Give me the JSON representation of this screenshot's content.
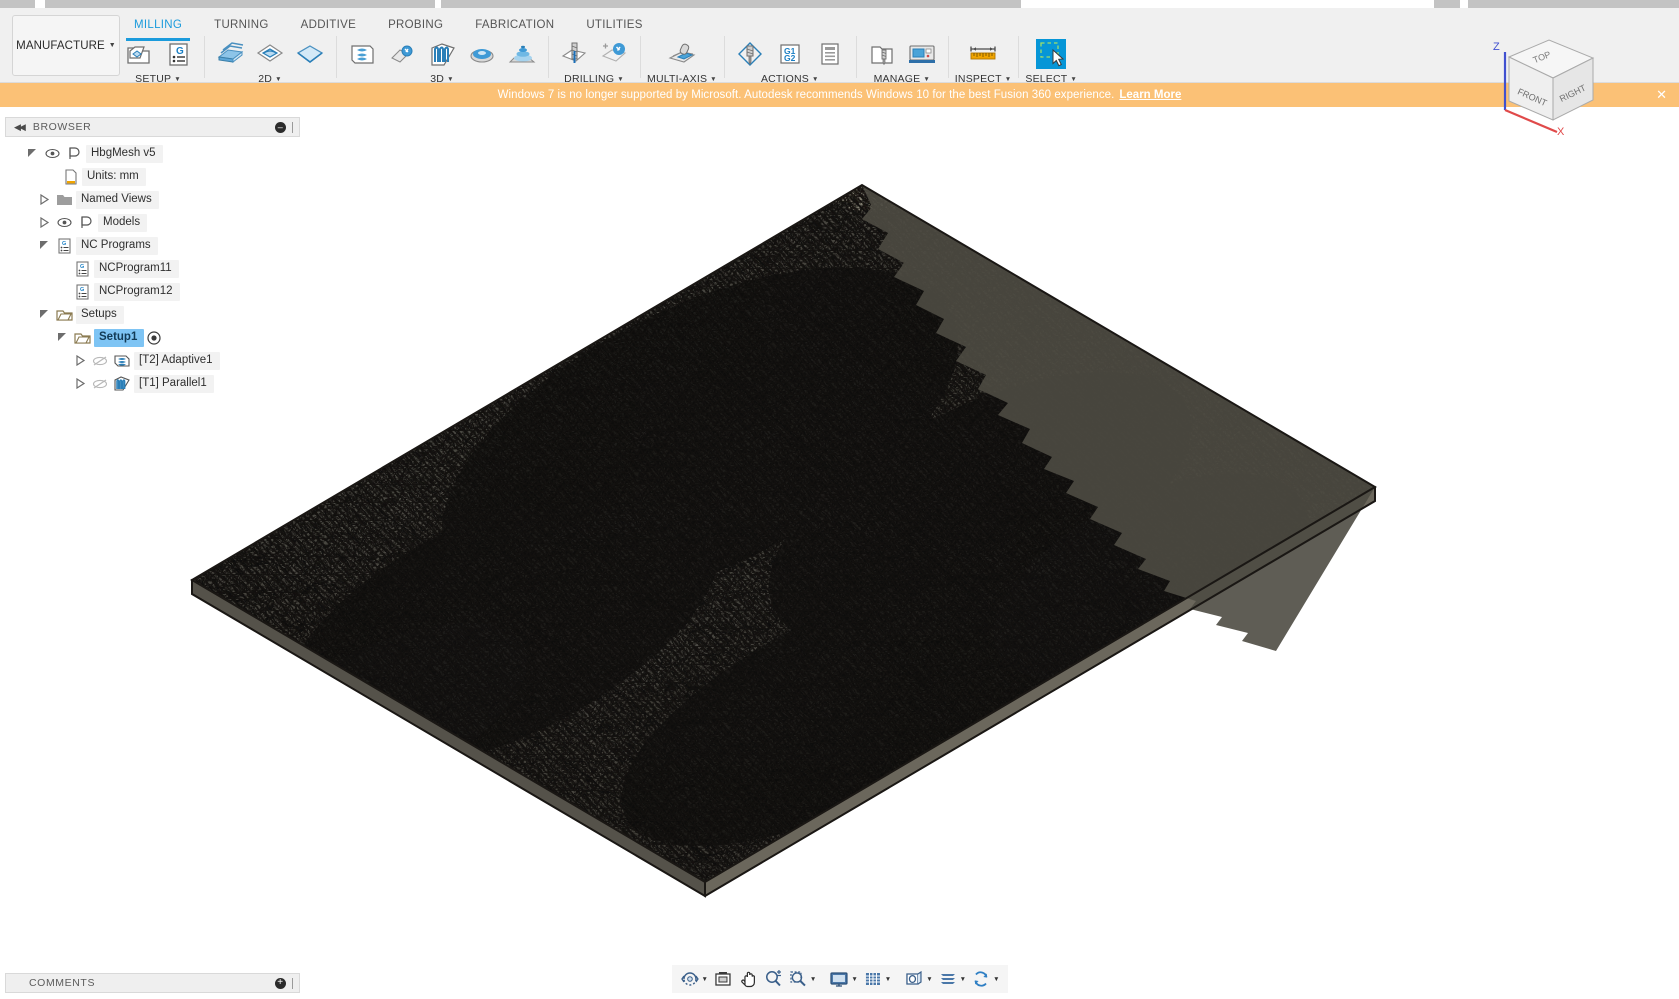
{
  "app": {
    "workspace_label": "MANUFACTURE",
    "tabs": [
      {
        "label": "MILLING",
        "active": true
      },
      {
        "label": "TURNING",
        "active": false
      },
      {
        "label": "ADDITIVE",
        "active": false
      },
      {
        "label": "PROBING",
        "active": false
      },
      {
        "label": "FABRICATION",
        "active": false
      },
      {
        "label": "UTILITIES",
        "active": false
      }
    ]
  },
  "ribbon": {
    "groups": [
      {
        "label": "SETUP",
        "icons": [
          "setup-folder-icon",
          "nc-program-icon"
        ]
      },
      {
        "label": "2D",
        "icons": [
          "face-icon",
          "pocket-2d-icon",
          "contour-2d-icon"
        ]
      },
      {
        "label": "3D",
        "icons": [
          "adaptive-clearing-icon",
          "pocket-clearing-icon",
          "parallel-icon",
          "scallop-icon",
          "spiral-icon"
        ]
      },
      {
        "label": "DRILLING",
        "icons": [
          "drill-icon",
          "bore-icon"
        ]
      },
      {
        "label": "MULTI-AXIS",
        "icons": [
          "swarf-icon"
        ]
      },
      {
        "label": "ACTIONS",
        "icons": [
          "simulate-icon",
          "post-process-icon",
          "setup-sheet-icon"
        ]
      },
      {
        "label": "MANAGE",
        "icons": [
          "tool-library-icon",
          "machine-library-icon"
        ]
      },
      {
        "label": "INSPECT",
        "icons": [
          "measure-icon"
        ]
      },
      {
        "label": "SELECT",
        "icons": [
          "select-box-icon"
        ]
      }
    ]
  },
  "banner": {
    "message": "Windows 7 is no longer supported by Microsoft. Autodesk recommends Windows 10 for the best Fusion 360 experience.",
    "link_label": "Learn More",
    "close_label": "✕",
    "bg_color": "#fbc176"
  },
  "browser": {
    "title": "BROWSER",
    "collapse_label": "◀◀",
    "minus_label": "–",
    "tree": [
      {
        "label": "HbgMesh v5",
        "depth": 0,
        "expander": "expanded",
        "eye": true,
        "icon": "component-icon",
        "selected": false
      },
      {
        "label": "Units: mm",
        "depth": 1,
        "expander": "none",
        "eye": false,
        "icon": "units-icon",
        "selected": false
      },
      {
        "label": "Named Views",
        "depth": 1,
        "expander": "collapsed",
        "eye": false,
        "icon": "folder-gray-icon",
        "selected": false
      },
      {
        "label": "Models",
        "depth": 1,
        "expander": "collapsed",
        "eye": true,
        "icon": "component-icon",
        "selected": false
      },
      {
        "label": "NC Programs",
        "depth": 1,
        "expander": "expanded",
        "eye": false,
        "icon": "nc-list-icon",
        "selected": false
      },
      {
        "label": "NCProgram11",
        "depth": 2,
        "expander": "none",
        "eye": false,
        "icon": "nc-list-icon",
        "selected": false
      },
      {
        "label": "NCProgram12",
        "depth": 2,
        "expander": "none",
        "eye": false,
        "icon": "nc-list-icon",
        "selected": false
      },
      {
        "label": "Setups",
        "depth": 1,
        "expander": "expanded",
        "eye": false,
        "icon": "setup-folder-icon",
        "selected": false
      },
      {
        "label": "Setup1",
        "depth": 2,
        "expander": "expanded",
        "eye": false,
        "icon": "setup-folder-icon",
        "selected": true,
        "focus_dot": true
      },
      {
        "label": "[T2] Adaptive1",
        "depth": 3,
        "expander": "collapsed",
        "eye": "off",
        "icon": "adaptive-op-icon",
        "selected": false
      },
      {
        "label": "[T1] Parallel1",
        "depth": 3,
        "expander": "collapsed",
        "eye": "off",
        "icon": "parallel-op-icon",
        "selected": false
      }
    ]
  },
  "comments": {
    "title": "COMMENTS",
    "plus_label": "+"
  },
  "navbar": {
    "buttons": [
      {
        "name": "orbit-icon",
        "has_caret": true
      },
      {
        "name": "look-at-icon",
        "has_caret": false
      },
      {
        "name": "pan-icon",
        "has_caret": false
      },
      {
        "name": "zoom-icon",
        "has_caret": false
      },
      {
        "name": "zoom-window-icon",
        "has_caret": true
      },
      {
        "name": "display-settings-icon",
        "has_caret": true
      },
      {
        "name": "grid-snaps-icon",
        "has_caret": true
      },
      {
        "name": "viewports-icon",
        "has_caret": true
      },
      {
        "name": "layout-grid-icon",
        "has_caret": true
      },
      {
        "name": "refresh-icon",
        "has_caret": true
      }
    ]
  },
  "viewcube": {
    "faces": {
      "top": "TOP",
      "front": "FRONT",
      "right": "RIGHT"
    },
    "axes": {
      "z": "Z",
      "x": "X"
    },
    "z_color": "#4050d0",
    "x_color": "#e04a4a"
  },
  "model": {
    "name": "HbgMesh v5",
    "kind": "triangulated-terrain-mesh",
    "face_color": "#7d7a70",
    "edge_color": "#14120f",
    "accent_color": "#1b9bdc"
  }
}
